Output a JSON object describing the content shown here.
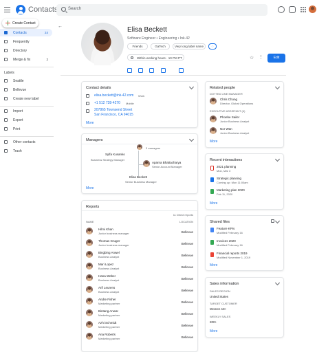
{
  "app": {
    "title": "Contacts",
    "search_placeholder": "Search"
  },
  "sidebar": {
    "create": "Create Contact",
    "items": [
      {
        "label": "Contacts",
        "count": "24"
      },
      {
        "label": "Frequently",
        "count": ""
      },
      {
        "label": "Directory",
        "count": ""
      },
      {
        "label": "Merge & fix",
        "count": "2"
      }
    ],
    "labels_heading": "Labels",
    "labels": [
      "Seattle",
      "Bellevue",
      "Create new label"
    ],
    "actions": [
      "Import",
      "Export",
      "Print"
    ],
    "bottom": [
      "Other contacts",
      "Trash"
    ]
  },
  "profile": {
    "name": "Elisa Beckett",
    "subtitle": "Software Engineer • Engineering • Ink-42",
    "chips": [
      "Friends",
      "GaTech",
      "Very long label name"
    ],
    "working_hours": "Within working hours · 10 PM PT",
    "edit": "Edit"
  },
  "contact_details": {
    "title": "Contact details",
    "email": "elisa.beckett@ink-42.com",
    "email_type": "Work",
    "phone": "+1 512 728-4270",
    "phone_type": "Mobile",
    "address_line1": "207865 Townsend Street",
    "address_line2": "San Francisco, CA 94015",
    "more": "More"
  },
  "managers": {
    "title": "Managers",
    "count": "3 managers",
    "left_name": "Sylfa Kusanko",
    "left_role": "Business Strategy Manager",
    "right_name": "Aparna Bhattacharya",
    "right_role": "Senior Account Manager",
    "center_name": "Elisa Beckett",
    "center_role": "Senior Business Manager",
    "more": "More"
  },
  "reports": {
    "title": "Reports",
    "summary": "11 Direct reports",
    "name_header": "NAME",
    "location_header": "LOCATION",
    "rows": [
      {
        "name": "Hilmi Khan",
        "role": "Junior business manager",
        "location": "Bellevue"
      },
      {
        "name": "Thomas Gruger",
        "role": "Junior business manager",
        "location": "Bellevue"
      },
      {
        "name": "Bingbing Anwel",
        "role": "Business Analyst",
        "location": "Bellevue"
      },
      {
        "name": "Mari Lopez",
        "role": "Business Analyst",
        "location": "Bellevue"
      },
      {
        "name": "Hana Weber",
        "role": "Business Analyst",
        "location": "Bellevue"
      },
      {
        "name": "Arif Leurens",
        "role": "Business Analyst",
        "location": "Bellevue"
      },
      {
        "name": "Andre Fisher",
        "role": "Marketing partner",
        "location": "Bellevue"
      },
      {
        "name": "Bintang Anwar",
        "role": "Marketing partner",
        "location": "Bellevue"
      },
      {
        "name": "Azhi Schmidt",
        "role": "Marketing partner",
        "location": "Bellevue"
      },
      {
        "name": "Ana Roberts",
        "role": "Marketing partner",
        "location": "Bellevue"
      }
    ]
  },
  "related": {
    "title": "Related people",
    "dotted": "DOTTED LINE MANAGER",
    "exec": "EXECUTIVE ASSISTANT (4)",
    "people": [
      {
        "name": "Chris Chong",
        "role": "Director, Global Operations"
      },
      {
        "name": "Phoebe Sailer",
        "role": "Junior Business Analyst"
      },
      {
        "name": "Nor Wan",
        "role": "Junior Business Analyst"
      }
    ],
    "more": "More"
  },
  "interactions": {
    "title": "Recent interactions",
    "items": [
      {
        "title": "2021 planning",
        "date": "Mon, Mar 3"
      },
      {
        "title": "Strategic planning",
        "date": "Coming up: Mon 11:00am"
      },
      {
        "title": "Marketing plan 2020",
        "date": "Feb 11, 2020"
      }
    ],
    "more": "More"
  },
  "shared": {
    "title": "Shared files",
    "items": [
      {
        "title": "Feature KPIs",
        "date": "Modified February 16"
      },
      {
        "title": "Invoices 2020",
        "date": "Modified February 16"
      },
      {
        "title": "Financial reports 2019",
        "date": "Modified November 1, 2019"
      }
    ],
    "more": "More"
  },
  "sales": {
    "title": "Sales information",
    "sales_region_label": "SALES REGION",
    "sales_region": "United States",
    "target_label": "TARGET CUSTOMER",
    "target": "Women 18+",
    "weekly_label": "WEEKLY SALES",
    "weekly": "200+",
    "more": "More"
  }
}
